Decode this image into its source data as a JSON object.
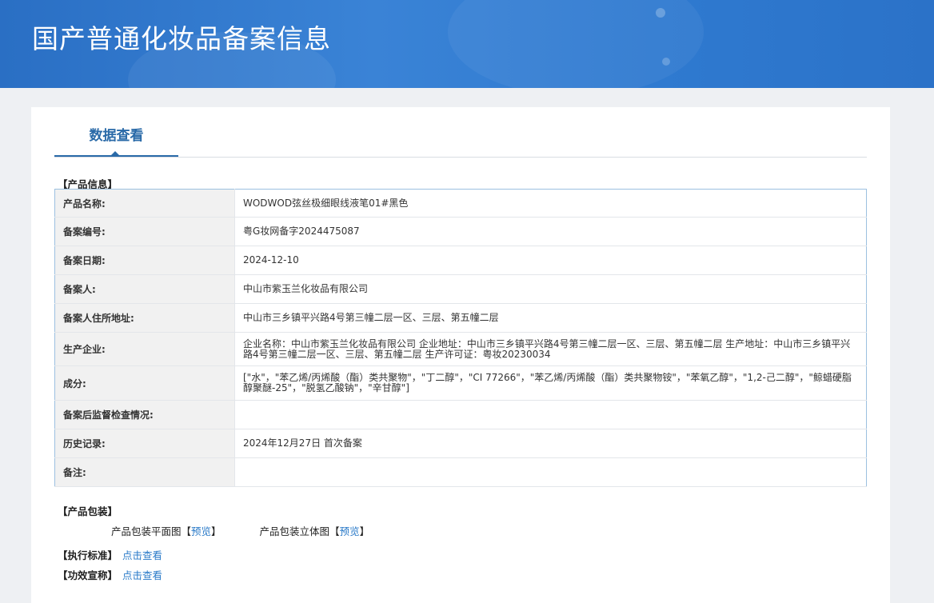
{
  "header": {
    "title": "国产普通化妆品备案信息"
  },
  "tabs": {
    "active_label": "数据查看"
  },
  "product_section": {
    "label": "【产品信息】",
    "rows": [
      {
        "key": "产品名称:",
        "value": "WODWOD弦丝极细眼线液笔01#黑色"
      },
      {
        "key": "备案编号:",
        "value": "粤G妆网备字2024475087"
      },
      {
        "key": "备案日期:",
        "value": "2024-12-10"
      },
      {
        "key": "备案人:",
        "value": "中山市紫玉兰化妆品有限公司"
      },
      {
        "key": "备案人住所地址:",
        "value": "中山市三乡镇平兴路4号第三幢二层一区、三层、第五幢二层"
      },
      {
        "key": "生产企业:",
        "value": "企业名称：中山市紫玉兰化妆品有限公司 企业地址：中山市三乡镇平兴路4号第三幢二层一区、三层、第五幢二层 生产地址：中山市三乡镇平兴路4号第三幢二层一区、三层、第五幢二层 生产许可证：粤妆20230034"
      },
      {
        "key": "成分:",
        "value": "[\"水\"，\"苯乙烯/丙烯酸（酯）类共聚物\"，\"丁二醇\"，\"CI 77266\"，\"苯乙烯/丙烯酸（酯）类共聚物铵\"，\"苯氧乙醇\"，\"1,2-己二醇\"，\"鲸蜡硬脂醇聚醚-25\"，\"脱氢乙酸钠\"，\"辛甘醇\"]"
      },
      {
        "key": "备案后监督检查情况:",
        "value": ""
      },
      {
        "key": "历史记录:",
        "value": "2024年12月27日 首次备案"
      },
      {
        "key": "备注:",
        "value": ""
      }
    ]
  },
  "packaging": {
    "label": "【产品包装】",
    "flat_label": "产品包装平面图",
    "solid_label": "产品包装立体图",
    "bracket_open": "【",
    "bracket_close": "】",
    "preview_link": "预览"
  },
  "standard": {
    "label": "【执行标准】",
    "link": "点击查看"
  },
  "efficacy": {
    "label": "【功效宣称】",
    "link": "点击查看"
  }
}
